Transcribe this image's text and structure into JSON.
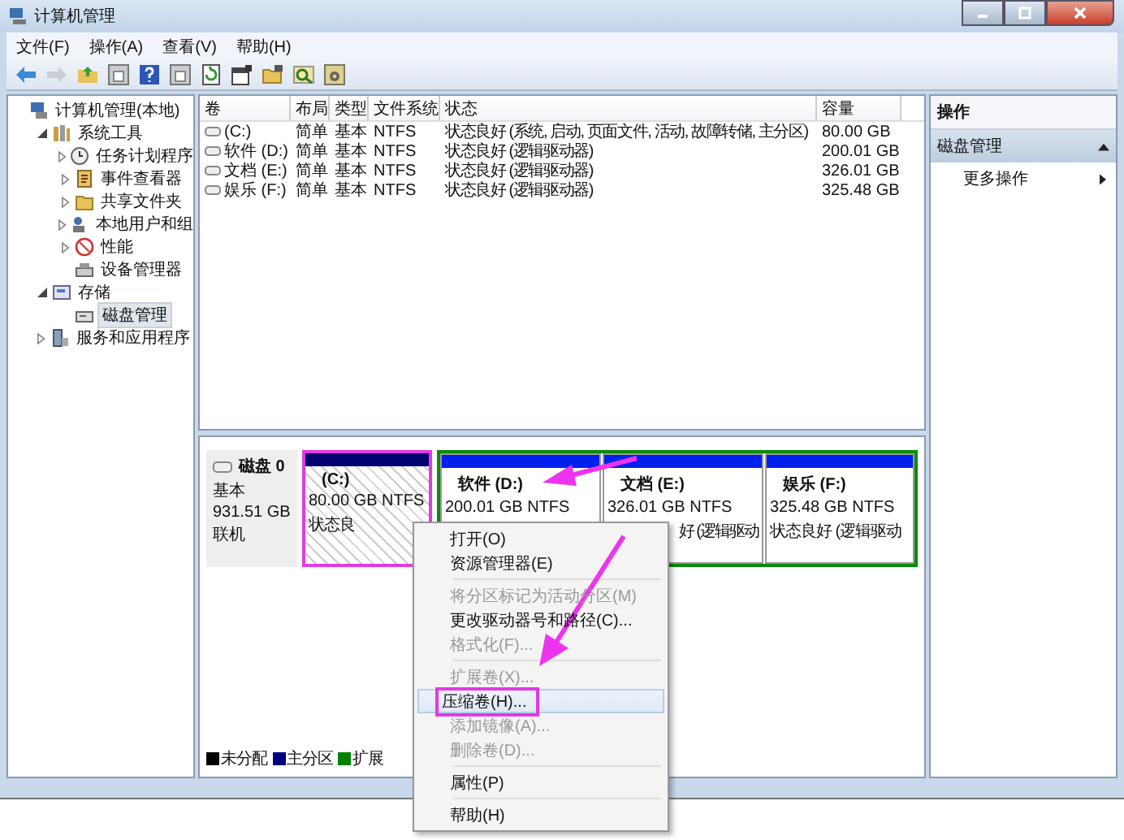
{
  "window": {
    "title": "计算机管理"
  },
  "menubar": [
    "文件(F)",
    "操作(A)",
    "查看(V)",
    "帮助(H)"
  ],
  "toolbar": [
    {
      "kind": "back",
      "disabled": false
    },
    {
      "kind": "forward",
      "disabled": true
    },
    {
      "kind": "up",
      "disabled": false
    },
    {
      "kind": "pane",
      "disabled": false
    },
    {
      "kind": "help",
      "disabled": false
    },
    {
      "kind": "pane",
      "disabled": false
    },
    {
      "kind": "refresh",
      "disabled": false
    },
    {
      "kind": "properties",
      "disabled": false
    },
    {
      "kind": "open",
      "disabled": false
    },
    {
      "kind": "search",
      "disabled": false
    },
    {
      "kind": "settings",
      "disabled": false
    }
  ],
  "tree": [
    {
      "label": "计算机管理(本地)",
      "kind": "computer",
      "selected": false,
      "children": [
        {
          "label": "系统工具",
          "kind": "tools",
          "expanded": true,
          "selected": false,
          "children": [
            {
              "label": "任务计划程序",
              "kind": "clock",
              "expanded": false,
              "selected": false
            },
            {
              "label": "事件查看器",
              "kind": "log",
              "expanded": false,
              "selected": false
            },
            {
              "label": "共享文件夹",
              "kind": "folder",
              "expanded": false,
              "selected": false
            },
            {
              "label": "本地用户和组",
              "kind": "users",
              "expanded": false,
              "selected": false
            },
            {
              "label": "性能",
              "kind": "gauge",
              "expanded": false,
              "selected": false
            },
            {
              "label": "设备管理器",
              "kind": "device",
              "selected": false
            }
          ]
        },
        {
          "label": "存储",
          "kind": "storage",
          "expanded": true,
          "selected": false,
          "children": [
            {
              "label": "磁盘管理",
              "kind": "disk",
              "selected": true
            }
          ]
        },
        {
          "label": "服务和应用程序",
          "kind": "services",
          "expanded": false,
          "selected": false
        }
      ]
    }
  ],
  "table": {
    "columns": [
      "卷",
      "布局",
      "类型",
      "文件系统",
      "状态",
      "容量"
    ],
    "rows": [
      [
        "(C:)",
        "简单",
        "基本",
        "NTFS",
        "状态良好 (系统, 启动, 页面文件, 活动, 故障转储, 主分区)",
        "80.00 GB"
      ],
      [
        "软件 (D:)",
        "简单",
        "基本",
        "NTFS",
        "状态良好 (逻辑驱动器)",
        "200.01 GB"
      ],
      [
        "文档 (E:)",
        "简单",
        "基本",
        "NTFS",
        "状态良好 (逻辑驱动器)",
        "326.01 GB"
      ],
      [
        "娱乐 (F:)",
        "简单",
        "基本",
        "NTFS",
        "状态良好 (逻辑驱动器)",
        "325.48 GB"
      ]
    ]
  },
  "disk": {
    "name": "磁盘 0",
    "type": "基本",
    "size": "931.51 GB",
    "status": "联机",
    "partitions": [
      {
        "kind": "primary",
        "name": "(C:)",
        "size": "80.00 GB NTFS",
        "status": "状态良",
        "selected": true,
        "highlighted": true
      },
      {
        "kind": "logical",
        "name": "软件 (D:)",
        "size": "200.01 GB NTFS",
        "selected": false,
        "highlighted": false
      },
      {
        "kind": "logical",
        "name": "文档 (E:)",
        "size": "326.01 GB NTFS",
        "status": "好 (逻辑驱动",
        "selected": false,
        "highlighted": false
      },
      {
        "kind": "logical",
        "name": "娱乐 (F:)",
        "size": "325.48 GB NTFS",
        "status": "状态良好 (逻辑驱动",
        "selected": false,
        "highlighted": false
      }
    ]
  },
  "legend": [
    {
      "label": "未分配",
      "color": "#000000"
    },
    {
      "label": "主分区",
      "color": "#000080"
    },
    {
      "label": "扩展",
      "color": "#008000"
    }
  ],
  "actions": {
    "header": "操作",
    "section": "磁盘管理",
    "items": [
      "更多操作"
    ]
  },
  "context_menu": [
    {
      "kind": "item",
      "label": "打开(O)",
      "disabled": false,
      "highlighted": false
    },
    {
      "kind": "item",
      "label": "资源管理器(E)",
      "disabled": false,
      "highlighted": false
    },
    {
      "kind": "separator"
    },
    {
      "kind": "item",
      "label": "将分区标记为活动分区(M)",
      "disabled": true,
      "highlighted": false
    },
    {
      "kind": "item",
      "label": "更改驱动器号和路径(C)...",
      "disabled": false,
      "highlighted": false
    },
    {
      "kind": "item",
      "label": "格式化(F)...",
      "disabled": true,
      "highlighted": false
    },
    {
      "kind": "separator"
    },
    {
      "kind": "item",
      "label": "扩展卷(X)...",
      "disabled": true,
      "highlighted": false
    },
    {
      "kind": "item",
      "label": "压缩卷(H)...",
      "disabled": false,
      "highlighted": true
    },
    {
      "kind": "item",
      "label": "添加镜像(A)...",
      "disabled": true,
      "highlighted": false
    },
    {
      "kind": "item",
      "label": "删除卷(D)...",
      "disabled": true,
      "highlighted": false
    },
    {
      "kind": "separator"
    },
    {
      "kind": "item",
      "label": "属性(P)",
      "disabled": false,
      "highlighted": false
    },
    {
      "kind": "separator"
    },
    {
      "kind": "item",
      "label": "帮助(H)",
      "disabled": false,
      "highlighted": false
    }
  ]
}
